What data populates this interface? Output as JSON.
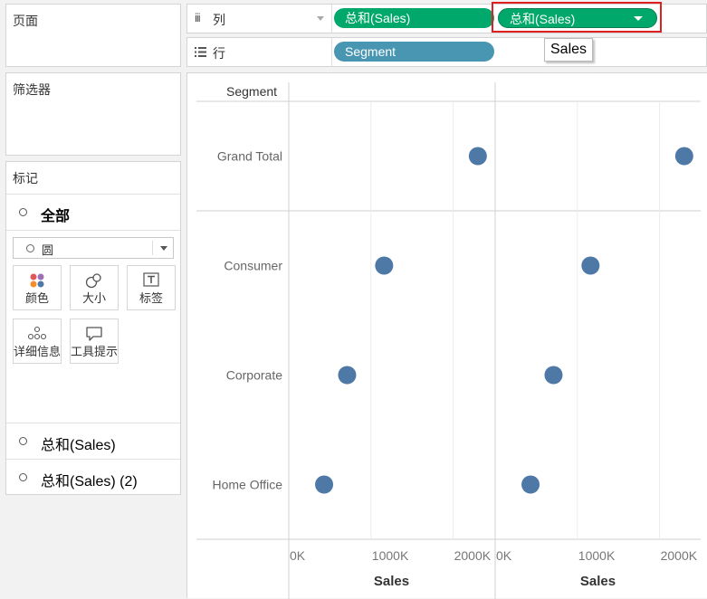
{
  "pages_panel": {
    "title": "页面"
  },
  "filters_panel": {
    "title": "筛选器"
  },
  "marks_panel": {
    "title": "标记",
    "all_label": "全部",
    "mark_type": "圆",
    "buttons": {
      "color": "颜色",
      "size": "大小",
      "label": "标签",
      "detail": "详细信息",
      "tooltip": "工具提示"
    },
    "measure_rows": [
      "总和(Sales)",
      "总和(Sales) (2)"
    ]
  },
  "columns_shelf": {
    "icon": "iii",
    "label": "列",
    "pills": [
      "总和(Sales)",
      "总和(Sales)"
    ]
  },
  "rows_shelf": {
    "label": "行",
    "pills": [
      "Segment"
    ]
  },
  "tooltip": {
    "text": "Sales"
  },
  "colors": {
    "accent_pill": "#00a86b",
    "dimension_pill": "#4996b2",
    "mark": "#4e79a7",
    "highlight_box": "#e02020"
  },
  "chart_data": {
    "type": "scatter",
    "row_header": "Segment",
    "categories": [
      "Grand Total",
      "Consumer",
      "Corporate",
      "Home Office"
    ],
    "panes": [
      {
        "xlabel": "Sales",
        "xlim": [
          0,
          2500000
        ],
        "tick_labels": [
          "0K",
          "1000K",
          "2000K"
        ],
        "tick_values": [
          0,
          1000000,
          2000000
        ],
        "values": [
          2300000,
          1160000,
          710000,
          430000
        ]
      },
      {
        "xlabel": "Sales",
        "xlim": [
          0,
          2500000
        ],
        "tick_labels": [
          "0K",
          "1000K",
          "2000K"
        ],
        "tick_values": [
          0,
          1000000,
          2000000
        ],
        "values": [
          2300000,
          1160000,
          710000,
          430000
        ]
      }
    ]
  }
}
